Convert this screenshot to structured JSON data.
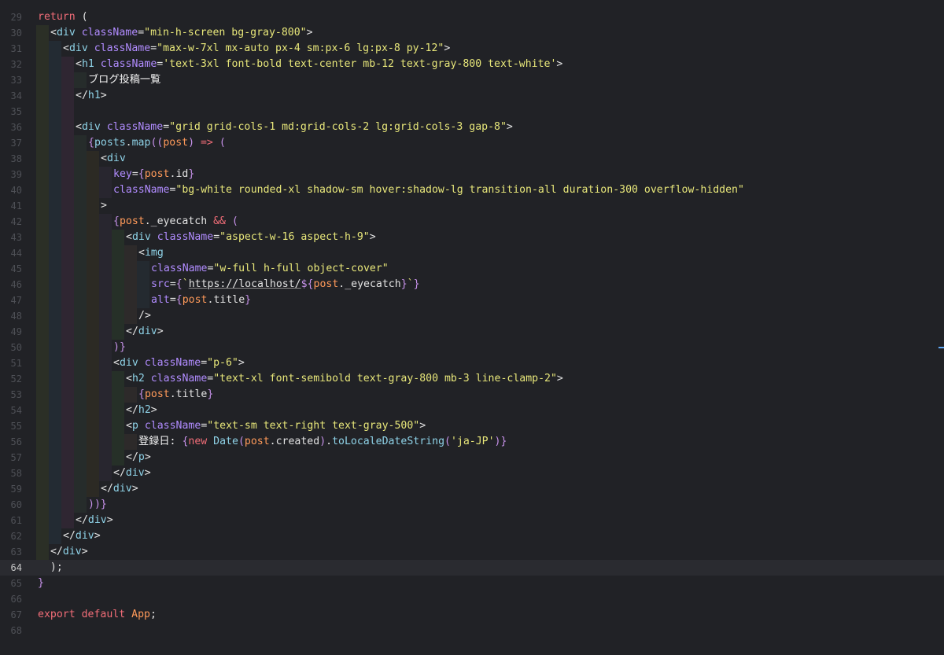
{
  "editor": {
    "language": "jsx",
    "active_line": 64,
    "lines": [
      {
        "num": "29",
        "indent": 0,
        "tokens": [
          [
            "kw",
            "return"
          ],
          [
            "punc",
            " ("
          ]
        ]
      },
      {
        "num": "30",
        "indent": 1,
        "tokens": [
          [
            "punc",
            "<"
          ],
          [
            "tag",
            "div"
          ],
          [
            "punc",
            " "
          ],
          [
            "attr",
            "className"
          ],
          [
            "punc",
            "="
          ],
          [
            "str",
            "\"min-h-screen bg-gray-800\""
          ],
          [
            "punc",
            ">"
          ]
        ]
      },
      {
        "num": "31",
        "indent": 2,
        "tokens": [
          [
            "punc",
            "<"
          ],
          [
            "tag",
            "div"
          ],
          [
            "punc",
            " "
          ],
          [
            "attr",
            "className"
          ],
          [
            "punc",
            "="
          ],
          [
            "str",
            "\"max-w-7xl mx-auto px-4 sm:px-6 lg:px-8 py-12\""
          ],
          [
            "punc",
            ">"
          ]
        ]
      },
      {
        "num": "32",
        "indent": 3,
        "tokens": [
          [
            "punc",
            "<"
          ],
          [
            "tag",
            "h1"
          ],
          [
            "punc",
            " "
          ],
          [
            "attr",
            "className"
          ],
          [
            "punc",
            "="
          ],
          [
            "str",
            "'text-3xl font-bold text-center mb-12 text-gray-800 text-white'"
          ],
          [
            "punc",
            ">"
          ]
        ]
      },
      {
        "num": "33",
        "indent": 4,
        "tokens": [
          [
            "jp",
            "ブログ投稿一覧"
          ]
        ]
      },
      {
        "num": "34",
        "indent": 3,
        "tokens": [
          [
            "punc",
            "</"
          ],
          [
            "tag",
            "h1"
          ],
          [
            "punc",
            ">"
          ]
        ]
      },
      {
        "num": "35",
        "indent": 3,
        "tokens": []
      },
      {
        "num": "36",
        "indent": 3,
        "tokens": [
          [
            "punc",
            "<"
          ],
          [
            "tag",
            "div"
          ],
          [
            "punc",
            " "
          ],
          [
            "attr",
            "className"
          ],
          [
            "punc",
            "="
          ],
          [
            "str",
            "\"grid grid-cols-1 md:grid-cols-2 lg:grid-cols-3 gap-8\""
          ],
          [
            "punc",
            ">"
          ]
        ]
      },
      {
        "num": "37",
        "indent": 4,
        "tokens": [
          [
            "brace",
            "{"
          ],
          [
            "fn",
            "posts"
          ],
          [
            "punc",
            "."
          ],
          [
            "fn",
            "map"
          ],
          [
            "brace",
            "(("
          ],
          [
            "var",
            "post"
          ],
          [
            "brace",
            ")"
          ],
          [
            "kw",
            " => "
          ],
          [
            "brace",
            "("
          ]
        ]
      },
      {
        "num": "38",
        "indent": 5,
        "tokens": [
          [
            "punc",
            "<"
          ],
          [
            "tag",
            "div"
          ]
        ]
      },
      {
        "num": "39",
        "indent": 6,
        "tokens": [
          [
            "attr",
            "key"
          ],
          [
            "punc",
            "="
          ],
          [
            "brace",
            "{"
          ],
          [
            "var",
            "post"
          ],
          [
            "punc",
            "."
          ],
          [
            "plain",
            "id"
          ],
          [
            "brace",
            "}"
          ]
        ]
      },
      {
        "num": "40",
        "indent": 6,
        "tokens": [
          [
            "attr",
            "className"
          ],
          [
            "punc",
            "="
          ],
          [
            "str",
            "\"bg-white rounded-xl shadow-sm hover:shadow-lg transition-all duration-300 overflow-hidden\""
          ]
        ]
      },
      {
        "num": "41",
        "indent": 5,
        "tokens": [
          [
            "punc",
            ">"
          ]
        ]
      },
      {
        "num": "42",
        "indent": 6,
        "tokens": [
          [
            "brace",
            "{"
          ],
          [
            "var",
            "post"
          ],
          [
            "punc",
            "."
          ],
          [
            "plain",
            "_eyecatch"
          ],
          [
            "kw",
            " && "
          ],
          [
            "brace",
            "("
          ]
        ]
      },
      {
        "num": "43",
        "indent": 7,
        "tokens": [
          [
            "punc",
            "<"
          ],
          [
            "tag",
            "div"
          ],
          [
            "punc",
            " "
          ],
          [
            "attr",
            "className"
          ],
          [
            "punc",
            "="
          ],
          [
            "str",
            "\"aspect-w-16 aspect-h-9\""
          ],
          [
            "punc",
            ">"
          ]
        ]
      },
      {
        "num": "44",
        "indent": 8,
        "tokens": [
          [
            "punc",
            "<"
          ],
          [
            "tag",
            "img"
          ]
        ]
      },
      {
        "num": "45",
        "indent": 9,
        "tokens": [
          [
            "attr",
            "className"
          ],
          [
            "punc",
            "="
          ],
          [
            "str",
            "\"w-full h-full object-cover\""
          ]
        ]
      },
      {
        "num": "46",
        "indent": 9,
        "tokens": [
          [
            "attr",
            "src"
          ],
          [
            "punc",
            "="
          ],
          [
            "brace",
            "{"
          ],
          [
            "str",
            "`"
          ],
          [
            "tmpl",
            "https://localhost/"
          ],
          [
            "brace",
            "${"
          ],
          [
            "var",
            "post"
          ],
          [
            "punc",
            "."
          ],
          [
            "plain",
            "_eyecatch"
          ],
          [
            "brace",
            "}"
          ],
          [
            "str",
            "`"
          ],
          [
            "brace",
            "}"
          ]
        ]
      },
      {
        "num": "47",
        "indent": 9,
        "tokens": [
          [
            "attr",
            "alt"
          ],
          [
            "punc",
            "="
          ],
          [
            "brace",
            "{"
          ],
          [
            "var",
            "post"
          ],
          [
            "punc",
            "."
          ],
          [
            "plain",
            "title"
          ],
          [
            "brace",
            "}"
          ]
        ]
      },
      {
        "num": "48",
        "indent": 8,
        "tokens": [
          [
            "punc",
            "/>"
          ]
        ]
      },
      {
        "num": "49",
        "indent": 7,
        "tokens": [
          [
            "punc",
            "</"
          ],
          [
            "tag",
            "div"
          ],
          [
            "punc",
            ">"
          ]
        ]
      },
      {
        "num": "50",
        "indent": 6,
        "tokens": [
          [
            "brace",
            ")}"
          ]
        ]
      },
      {
        "num": "51",
        "indent": 6,
        "tokens": [
          [
            "punc",
            "<"
          ],
          [
            "tag",
            "div"
          ],
          [
            "punc",
            " "
          ],
          [
            "attr",
            "className"
          ],
          [
            "punc",
            "="
          ],
          [
            "str",
            "\"p-6\""
          ],
          [
            "punc",
            ">"
          ]
        ]
      },
      {
        "num": "52",
        "indent": 7,
        "tokens": [
          [
            "punc",
            "<"
          ],
          [
            "tag",
            "h2"
          ],
          [
            "punc",
            " "
          ],
          [
            "attr",
            "className"
          ],
          [
            "punc",
            "="
          ],
          [
            "str",
            "\"text-xl font-semibold text-gray-800 mb-3 line-clamp-2\""
          ],
          [
            "punc",
            ">"
          ]
        ]
      },
      {
        "num": "53",
        "indent": 8,
        "tokens": [
          [
            "brace",
            "{"
          ],
          [
            "var",
            "post"
          ],
          [
            "punc",
            "."
          ],
          [
            "plain",
            "title"
          ],
          [
            "brace",
            "}"
          ]
        ]
      },
      {
        "num": "54",
        "indent": 7,
        "tokens": [
          [
            "punc",
            "</"
          ],
          [
            "tag",
            "h2"
          ],
          [
            "punc",
            ">"
          ]
        ]
      },
      {
        "num": "55",
        "indent": 7,
        "tokens": [
          [
            "punc",
            "<"
          ],
          [
            "tag",
            "p"
          ],
          [
            "punc",
            " "
          ],
          [
            "attr",
            "className"
          ],
          [
            "punc",
            "="
          ],
          [
            "str",
            "\"text-sm text-right text-gray-500\""
          ],
          [
            "punc",
            ">"
          ]
        ]
      },
      {
        "num": "56",
        "indent": 8,
        "tokens": [
          [
            "jp",
            "登録日: "
          ],
          [
            "brace",
            "{"
          ],
          [
            "kw",
            "new "
          ],
          [
            "fn",
            "Date"
          ],
          [
            "brace",
            "("
          ],
          [
            "var",
            "post"
          ],
          [
            "punc",
            "."
          ],
          [
            "plain",
            "created"
          ],
          [
            "brace",
            ")"
          ],
          [
            "punc",
            "."
          ],
          [
            "fn",
            "toLocaleDateString"
          ],
          [
            "brace",
            "("
          ],
          [
            "str",
            "'ja-JP'"
          ],
          [
            "brace",
            ")}"
          ]
        ]
      },
      {
        "num": "57",
        "indent": 7,
        "tokens": [
          [
            "punc",
            "</"
          ],
          [
            "tag",
            "p"
          ],
          [
            "punc",
            ">"
          ]
        ]
      },
      {
        "num": "58",
        "indent": 6,
        "tokens": [
          [
            "punc",
            "</"
          ],
          [
            "tag",
            "div"
          ],
          [
            "punc",
            ">"
          ]
        ]
      },
      {
        "num": "59",
        "indent": 5,
        "tokens": [
          [
            "punc",
            "</"
          ],
          [
            "tag",
            "div"
          ],
          [
            "punc",
            ">"
          ]
        ]
      },
      {
        "num": "60",
        "indent": 4,
        "tokens": [
          [
            "brace",
            "))}"
          ]
        ]
      },
      {
        "num": "61",
        "indent": 3,
        "tokens": [
          [
            "punc",
            "</"
          ],
          [
            "tag",
            "div"
          ],
          [
            "punc",
            ">"
          ]
        ]
      },
      {
        "num": "62",
        "indent": 2,
        "tokens": [
          [
            "punc",
            "</"
          ],
          [
            "tag",
            "div"
          ],
          [
            "punc",
            ">"
          ]
        ]
      },
      {
        "num": "63",
        "indent": 1,
        "tokens": [
          [
            "punc",
            "</"
          ],
          [
            "tag",
            "div"
          ],
          [
            "punc",
            ">"
          ]
        ]
      },
      {
        "num": "64",
        "indent": 0,
        "tokens": [
          [
            "punc",
            "  );"
          ]
        ]
      },
      {
        "num": "65",
        "indent": 0,
        "tokens": [
          [
            "brace",
            "}"
          ]
        ]
      },
      {
        "num": "66",
        "indent": 0,
        "tokens": []
      },
      {
        "num": "67",
        "indent": 0,
        "tokens": [
          [
            "kw",
            "export"
          ],
          [
            "punc",
            " "
          ],
          [
            "kw",
            "default"
          ],
          [
            "punc",
            " "
          ],
          [
            "var",
            "App"
          ],
          [
            "punc",
            ";"
          ]
        ]
      },
      {
        "num": "68",
        "indent": 0,
        "tokens": []
      }
    ]
  }
}
